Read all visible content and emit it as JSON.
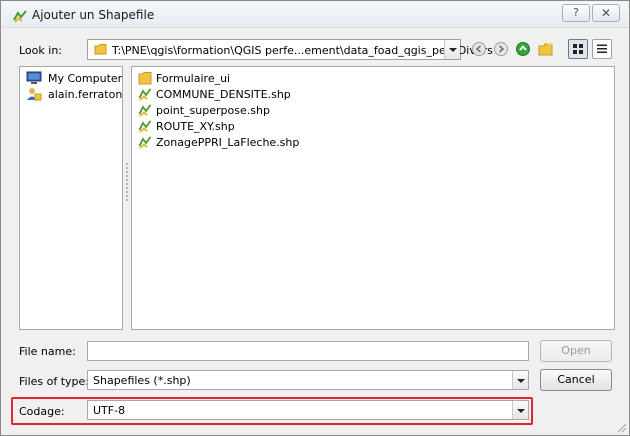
{
  "window": {
    "title": "Ajouter un Shapefile",
    "help_glyph": "?",
    "close_glyph": "✕"
  },
  "lookin": {
    "label": "Look in:",
    "path": "T:\\PNE\\qgis\\formation\\QGIS perfe...ement\\data_foad_qgis_perf\\Divers"
  },
  "toolbar": {
    "icons": [
      "back-icon",
      "forward-icon",
      "up-icon",
      "new-folder-icon",
      "detail-view-icon",
      "list-view-icon"
    ]
  },
  "sidebar": {
    "items": [
      {
        "label": "My Computer",
        "icon": "computer-icon"
      },
      {
        "label": "alain.ferraton",
        "icon": "user-icon"
      }
    ]
  },
  "files": [
    {
      "name": "Formulaire_ui",
      "icon": "folder-icon"
    },
    {
      "name": "COMMUNE_DENSITE.shp",
      "icon": "shapefile-icon"
    },
    {
      "name": "point_superpose.shp",
      "icon": "shapefile-icon"
    },
    {
      "name": "ROUTE_XY.shp",
      "icon": "shapefile-icon"
    },
    {
      "name": "ZonagePPRI_LaFleche.shp",
      "icon": "shapefile-icon"
    }
  ],
  "filename": {
    "label": "File name:",
    "value": "",
    "open_label": "Open"
  },
  "filetype": {
    "label": "Files of type:",
    "value": "Shapefiles (*.shp)",
    "cancel_label": "Cancel"
  },
  "encoding": {
    "label": "Codage:",
    "value": "UTF-8",
    "highlight_color": "#e0262b"
  },
  "colors": {
    "window_bg": "#f0f0f0",
    "folder": "#f2c541",
    "shapefile_stroke": "#4a9a2a"
  }
}
